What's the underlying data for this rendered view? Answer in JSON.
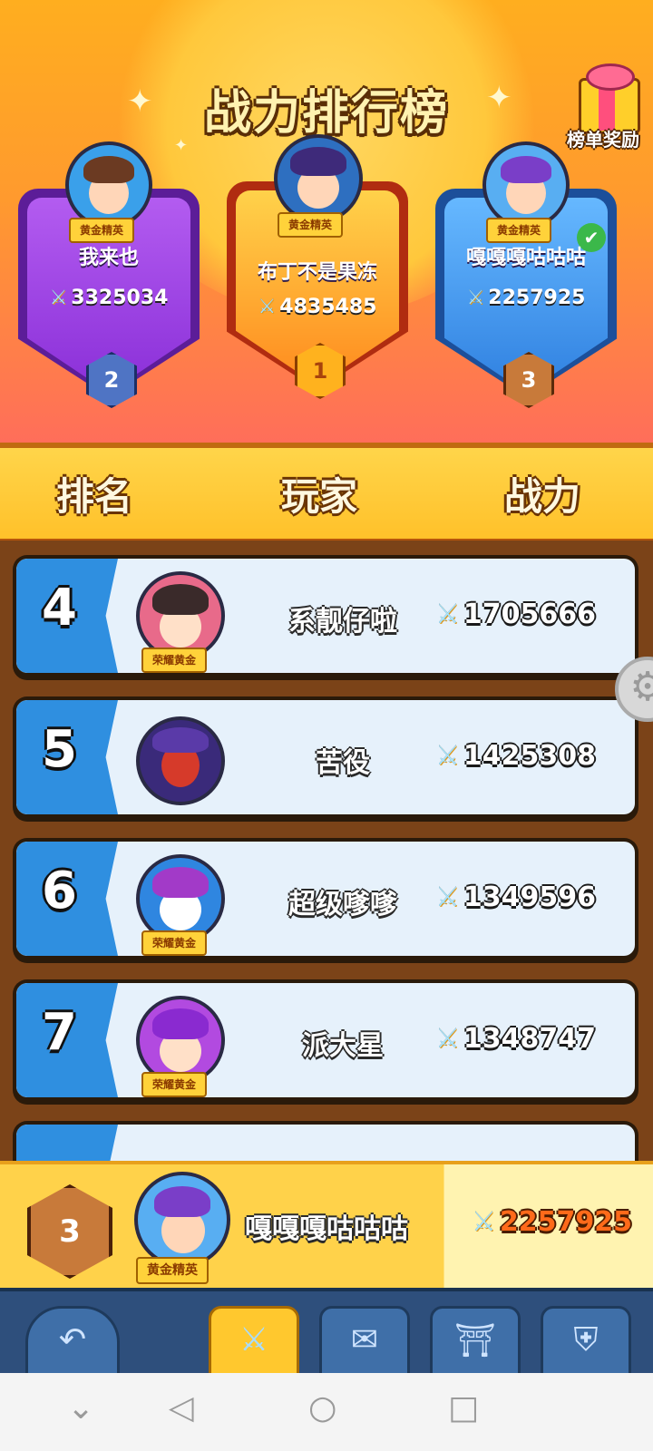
{
  "header": {
    "title": "战力排行榜",
    "reward_label": "榜单奖励"
  },
  "podium": [
    {
      "rank": "2",
      "name": "我来也",
      "power": "3325034",
      "title_badge": "黄金精英",
      "color": "#9a3fe0"
    },
    {
      "rank": "1",
      "name": "布丁不是果冻",
      "power": "4835485",
      "title_badge": "黄金精英",
      "color": "#ff8a1e"
    },
    {
      "rank": "3",
      "name": "嘎嘎嘎咕咕咕",
      "power": "2257925",
      "title_badge": "黄金精英",
      "color": "#3a8ce8"
    }
  ],
  "columns": {
    "rank": "排名",
    "player": "玩家",
    "power": "战力"
  },
  "rows": [
    {
      "rank": "4",
      "name": "系靓仔啦",
      "power": "1705666",
      "title_badge": "荣耀黄金"
    },
    {
      "rank": "5",
      "name": "苦役",
      "power": "1425308",
      "title_badge": ""
    },
    {
      "rank": "6",
      "name": "超级嗲嗲",
      "power": "1349596",
      "title_badge": "荣耀黄金"
    },
    {
      "rank": "7",
      "name": "派大星",
      "power": "1348747",
      "title_badge": "荣耀黄金"
    }
  ],
  "me": {
    "rank": "3",
    "name": "嘎嘎嘎咕咕咕",
    "power": "2257925",
    "title_badge": "黄金精英"
  },
  "icons": {
    "gift": "gift-icon",
    "swords": "crossed-swords-icon",
    "friend": "friend-check-icon",
    "back": "back-arrow-icon",
    "scroll": "scroll-map-icon",
    "gate": "gate-icon",
    "shield": "shield-icon",
    "gear": "gear-icon"
  }
}
